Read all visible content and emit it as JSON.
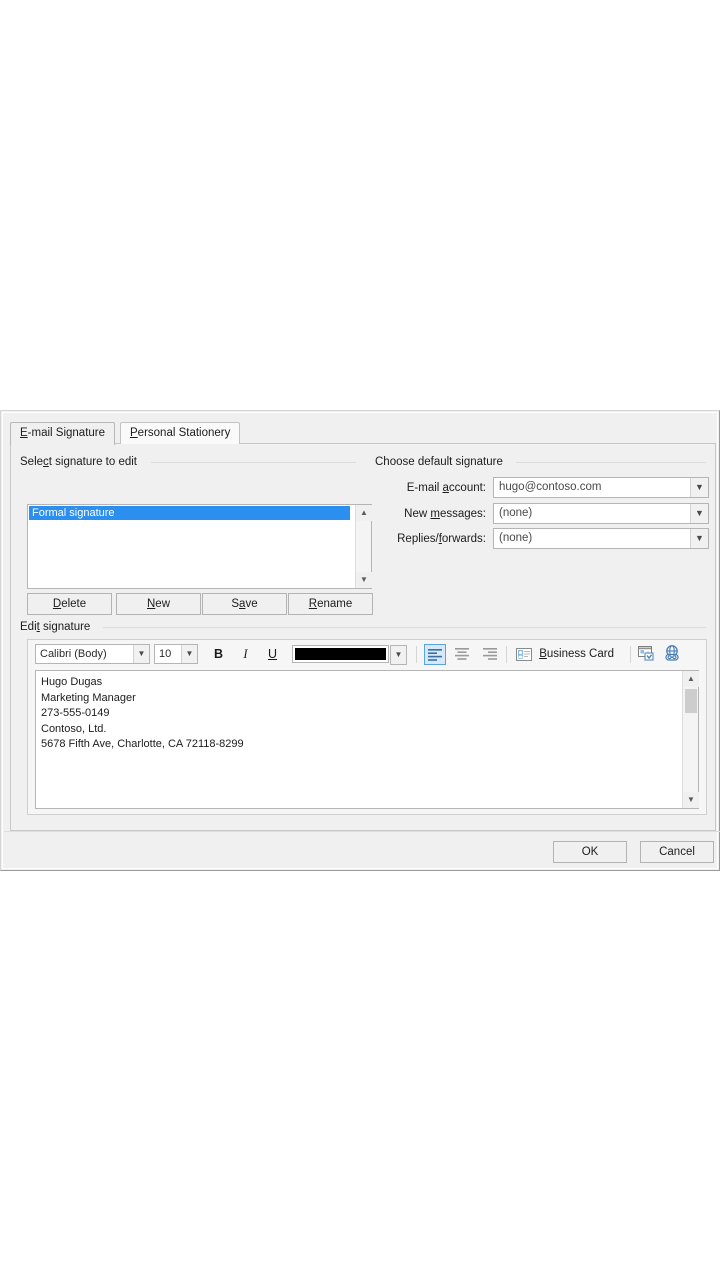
{
  "dialog": {
    "tabs": [
      {
        "label": "E-mail Signature",
        "accel": "E",
        "active": true,
        "name": "tab-email-signature"
      },
      {
        "label": "Personal Stationery",
        "accel": "P",
        "active": false,
        "name": "tab-personal-stationery"
      }
    ]
  },
  "select_group": {
    "label": "Select signature to edit",
    "listbox": {
      "items": [
        "Formal signature"
      ],
      "selected_index": 0
    },
    "buttons": [
      {
        "label": "Delete",
        "accel": "D",
        "name": "delete-button"
      },
      {
        "label": "New",
        "accel": "N",
        "name": "new-button"
      },
      {
        "label": "Save",
        "accel": "S",
        "name": "save-button"
      },
      {
        "label": "Rename",
        "accel": "R",
        "name": "rename-button"
      }
    ]
  },
  "default_group": {
    "label": "Choose default signature",
    "fields": [
      {
        "label": "E-mail account:",
        "accel": "a",
        "value": "hugo@contoso.com",
        "name": "email-account-combo"
      },
      {
        "label": "New messages:",
        "accel": "m",
        "value": "(none)",
        "name": "new-messages-combo"
      },
      {
        "label": "Replies/forwards:",
        "accel": "f",
        "value": "(none)",
        "name": "replies-forwards-combo"
      }
    ]
  },
  "edit_group": {
    "label": "Edit signature",
    "toolbar": {
      "font_family": "Calibri (Body)",
      "font_size": "10",
      "bold_label": "B",
      "italic_label": "I",
      "underline_label": "U",
      "font_color": "#000000",
      "align_left_label": "Align Left",
      "align_center_label": "Center",
      "align_right_label": "Align Right",
      "align_active": "left",
      "business_card_label": "Business Card",
      "business_card_accel": "B",
      "insert_picture_label": "Insert Picture",
      "insert_hyperlink_label": "Insert Hyperlink"
    },
    "signature_text": "Hugo Dugas\nMarketing Manager\n273-555-0149\nContoso, Ltd.\n5678 Fifth Ave, Charlotte, CA 72118-8299"
  },
  "footer": {
    "ok_label": "OK",
    "cancel_label": "Cancel"
  },
  "colors": {
    "selection_blue": "#2a8fef",
    "toggle_active_bg": "#d6e9f8",
    "toggle_active_border": "#5ba3dd",
    "dialog_bg": "#f0f0f0"
  }
}
